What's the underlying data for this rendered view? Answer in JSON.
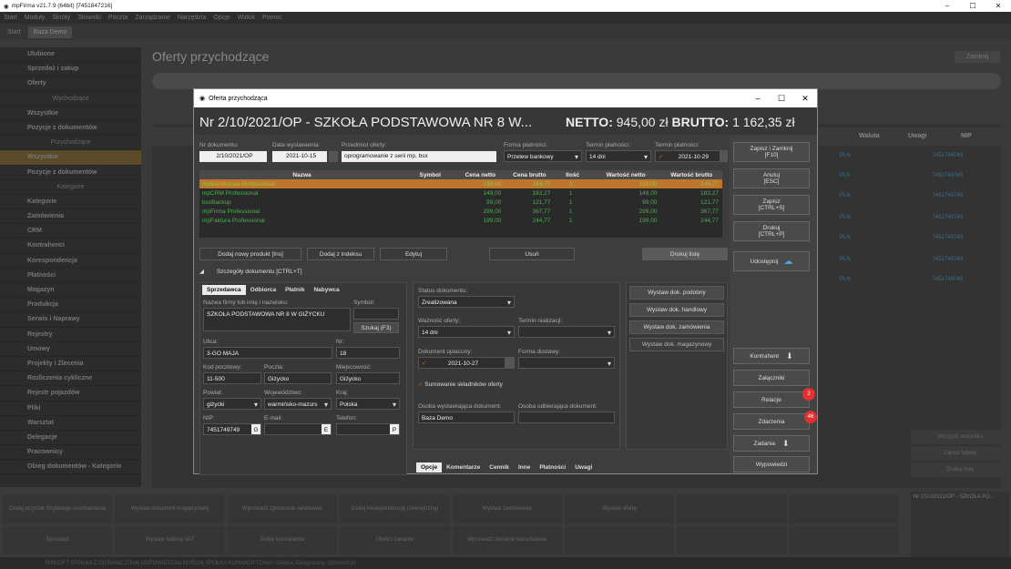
{
  "app": {
    "title": "mpFirma v21.7.9 (64bit) [7451847216]",
    "menu": [
      "Start",
      "Moduły",
      "Skróty",
      "Słowniki",
      "Poczta",
      "Zarządzanie",
      "Narzędzia",
      "Opcje",
      "Widok",
      "Pomoc"
    ],
    "tabs": [
      "Start",
      "Baza Demo"
    ]
  },
  "sidebar": {
    "items": [
      "Ulubione",
      "Sprzedaż i zakup",
      "Oferty",
      "Wychodzące",
      "Wszystkie",
      "Pozycje z dokumentów",
      "Przychodzące",
      "Wszystkie",
      "Pozycje z dokumentów",
      "Kategorie",
      "Kategorie",
      "Zamówienia",
      "CRM",
      "Kontrahenci",
      "Korespondencja",
      "Płatności",
      "Magazyn",
      "Produkcja",
      "Serwis i Naprawy",
      "Rejestry",
      "Umowy",
      "Projekty i Zlecenia",
      "Rozliczenia cykliczne",
      "Rejestr pojazdów",
      "Pliki",
      "Warsztat",
      "Delegacje",
      "Pracownicy",
      "Obieg dokumentów - Kategorie"
    ]
  },
  "background": {
    "page_title": "Oferty przychodzące",
    "close_label": "Zamknij",
    "col_waluta": "Waluta",
    "col_uwagi": "Uwagi",
    "col_nip": "NIP",
    "currency": "PLN",
    "nip": "7451749749",
    "right_buttons": [
      "Wyczyść wszystko",
      "Zapisz tabelę",
      "Drukuj listę"
    ],
    "thumb_title": "Nr 2/10/2021/OP - SZKOŁA PO...",
    "bottom": [
      "Dodaj przycisk Szybkiego uruchamiania",
      "Wystaw dokument magazynowy",
      "Wprowadź zgłoszenie serwisowe",
      "Dodaj korespondencję (zewnętrzną)",
      "Wystaw zamówienie",
      "Wystaw ofertę",
      "",
      "",
      "Sprzedaż",
      "Wystaw fakturę VAT",
      "Dodaj kontrahenta",
      "Utwórz zadanie",
      "Wprowadź zlecenie warsztatowe",
      "",
      "",
      ""
    ],
    "status": "BINSOFT SPÓŁKA Z OGRANICZONĄ ODPOWIEDZIALNOŚCIĄ SPÓŁKA KOMANDYTOWA \\ Gliwice   Zalogowany: @binsoft.pl"
  },
  "dialog": {
    "window_title": "Oferta przychodząca",
    "header_title": "Nr 2/10/2021/OP - SZKOŁA PODSTAWOWA NR 8 W...",
    "netto_label": "NETTO:",
    "netto_value": "945,00 zł",
    "brutto_label": "BRUTTO:",
    "brutto_value": "1 162,35 zł",
    "fields": {
      "nr_label": "Nr dokumentu:",
      "nr": "2/10/2021/OP",
      "data_label": "Data wystawienia:",
      "data": "2021-10-15",
      "przedmiot_label": "Przedmiot oferty:",
      "przedmiot": "oprogramowanie z serii mp, bsx",
      "forma_label": "Forma płatności:",
      "forma": "Przelew bankowy",
      "termin_label": "Termin płatności:",
      "termin": "14 dni",
      "termin2_label": "Termin płatności:",
      "termin2": "2021-10-29"
    },
    "table": {
      "headers": [
        "Nazwa",
        "Symbol",
        "Cena netto",
        "Cena brutto",
        "Ilość",
        "Wartość netto",
        "Wartość brutto"
      ],
      "rows": [
        [
          "mpWarehouse Professional",
          "",
          "199,00",
          "244,77",
          "1",
          "199,00",
          "244,77"
        ],
        [
          "mpCRM Professional",
          "",
          "149,00",
          "183,27",
          "1",
          "149,00",
          "183,27"
        ],
        [
          "bsxBackup",
          "",
          "99,00",
          "121,77",
          "1",
          "99,00",
          "121,77"
        ],
        [
          "mpFirma Professional",
          "",
          "299,00",
          "367,77",
          "1",
          "299,00",
          "367,77"
        ],
        [
          "mpFaktura Professional",
          "",
          "199,00",
          "244,77",
          "1",
          "199,00",
          "244,77"
        ]
      ]
    },
    "actions": {
      "add": "Dodaj nowy produkt [Ins]",
      "add_index": "Dodaj z indeksu",
      "edit": "Edytuj",
      "delete": "Usuń",
      "print_list": "Drukuj listę"
    },
    "details_toggle": "Szczegóły dokumentu [CTRL+T]",
    "party_tabs": [
      "Sprzedawca",
      "Odbiorca",
      "Płatnik",
      "Nabywca"
    ],
    "party": {
      "name_label": "Nazwa firmy lub imię i nazwisko:",
      "name": "SZKOŁA PODSTAWOWA NR 8 W GIŻYCKU",
      "symbol_label": "Symbol:",
      "search_btn": "Szukaj (F3)",
      "street_label": "Ulica:",
      "street": "3-GO MAJA",
      "nr_label": "Nr:",
      "nr": "18",
      "zip_label": "Kod pocztowy:",
      "zip": "11-500",
      "post_label": "Poczta:",
      "post": "Giżycko",
      "city_label": "Miejscowość:",
      "city": "Giżycko",
      "county_label": "Powiat:",
      "county": "giżycki",
      "voiv_label": "Województwo:",
      "voiv": "warmińsko-mazurs",
      "country_label": "Kraj:",
      "country": "Polska",
      "nip_label": "NIP:",
      "nip": "7451749749",
      "email_label": "E-mail:",
      "phone_label": "Telefon:"
    },
    "status": {
      "status_label": "Status dokumentu:",
      "status": "Zrealizowana",
      "valid_label": "Ważność oferty:",
      "valid": "14 dni",
      "realization_label": "Termin realizacji:",
      "paid_label": "Dokument opłacony:",
      "paid_date": "2021-10-27",
      "delivery_label": "Forma dostawy:",
      "sum_label": "Sumowanie składników oferty",
      "issuer_label": "Osoba wystawiająca dokument:",
      "issuer": "Baza Demo",
      "receiver_label": "Osoba odbierająca dokument:"
    },
    "mid_buttons": [
      "Wystaw dok. podobny",
      "Wystaw dok. handlowy",
      "Wystaw dok. zamówienia",
      "Wystaw dok. magazynowy"
    ],
    "bottom_tabs": [
      "Opcje",
      "Komentarze",
      "Cennik",
      "Inne",
      "Płatności",
      "Uwagi"
    ],
    "right": {
      "save_close": "Zapisz i Zamknij",
      "save_close_key": "[F10]",
      "cancel": "Anuluj",
      "cancel_key": "[ESC]",
      "save": "Zapisz",
      "save_key": "[CTRL+S]",
      "print": "Drukuj",
      "print_key": "[CTRL+P]",
      "share": "Udostępnij",
      "contractor": "Kontrahent",
      "attachments": "Załączniki",
      "relations": "Relacje",
      "relations_count": "2",
      "events": "Zdarzenia",
      "events_count": "46",
      "tasks": "Zadania",
      "statements": "Wypowiedzi"
    }
  },
  "colors": {
    "accent": "#c0762a",
    "green_text": "#4caf50",
    "badge": "#e03030"
  }
}
